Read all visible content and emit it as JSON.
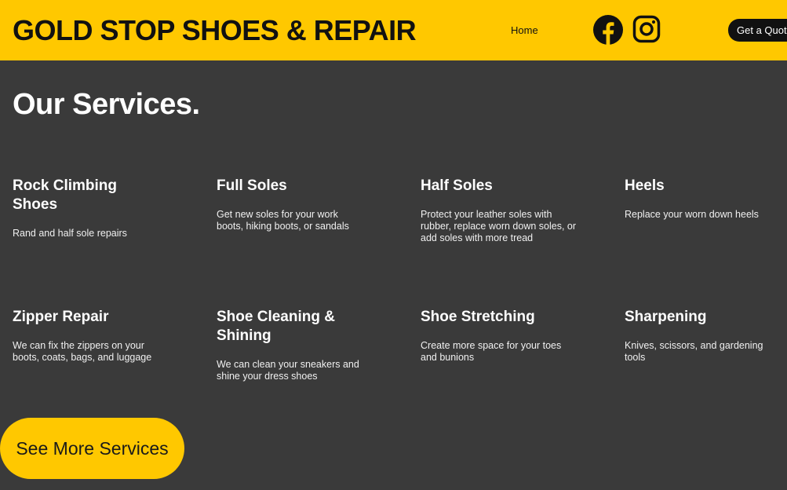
{
  "header": {
    "brand": "GOLD STOP SHOES & REPAIR",
    "nav_home": "Home",
    "social": [
      "facebook-icon",
      "instagram-icon"
    ],
    "quote_button": "Get a Quote"
  },
  "main": {
    "title": "Our Services.",
    "services": [
      {
        "title": "Rock Climbing Shoes",
        "description": "Rand and half sole repairs"
      },
      {
        "title": "Full Soles",
        "description": "Get new soles for your work boots, hiking boots, or sandals"
      },
      {
        "title": "Half Soles",
        "description": "Protect your leather soles with rubber, replace worn down soles, or add soles with more tread"
      },
      {
        "title": "Heels",
        "description": "Replace your worn down heels"
      },
      {
        "title": "Zipper Repair",
        "description": "We can fix the zippers on your boots, coats, bags, and luggage"
      },
      {
        "title": "Shoe Cleaning & Shining",
        "description": "We can clean your sneakers and shine your dress shoes"
      },
      {
        "title": "Shoe Stretching",
        "description": "Create more space for your toes and bunions"
      },
      {
        "title": "Sharpening",
        "description": "Knives, scissors, and gardening tools"
      }
    ],
    "more_button": "See More Services"
  },
  "colors": {
    "accent": "#ffc800",
    "background": "#3a3a3a",
    "dark": "#111111"
  }
}
